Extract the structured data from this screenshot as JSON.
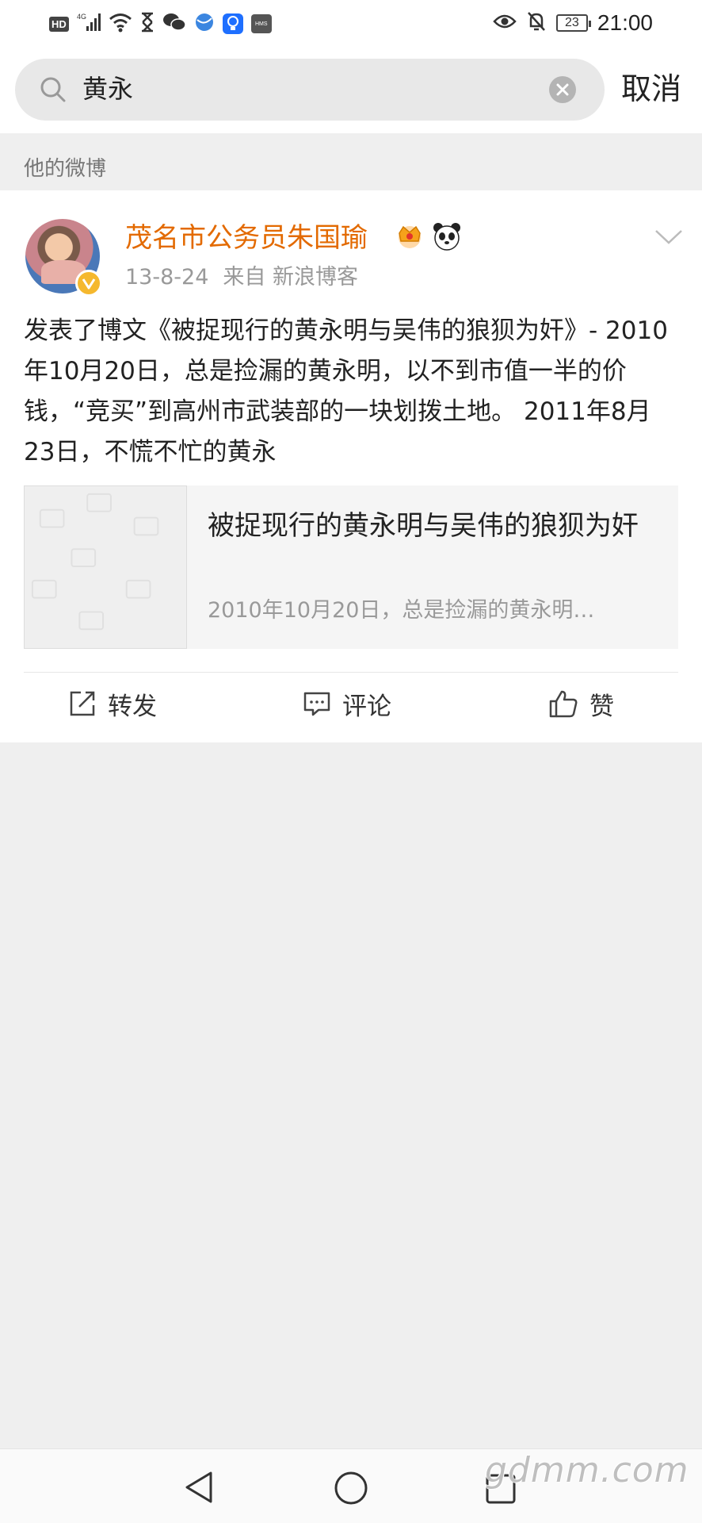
{
  "status_bar": {
    "hd_label": "HD",
    "network_label": "4G",
    "hms_label": "HMS",
    "battery_level": "23",
    "time": "21:00"
  },
  "search": {
    "query": "黄永",
    "cancel_label": "取消"
  },
  "section": {
    "label": "他的微博"
  },
  "post": {
    "author": "茂名市公务员朱国瑜",
    "date": "13-8-24",
    "source": "来自 新浪博客",
    "body": "发表了博文《被捉现行的黄永明与吴伟的狼狈为奸》- 2010年10月20日，总是捡漏的黄永明，以不到市值一半的价钱，“竞买”到高州市武装部的一块划拨土地。 2011年8月23日，不慌不忙的黄永",
    "link_card": {
      "title": "被捉现行的黄永明与吴伟的狼狈为奸",
      "description": "2010年10月20日，总是捡漏的黄永明…"
    },
    "actions": {
      "repost_label": "转发",
      "comment_label": "评论",
      "like_label": "赞"
    }
  },
  "watermark": {
    "text": "gdmm.com"
  },
  "colors": {
    "username": "#e36a00",
    "page_background": "#efefef",
    "verified_badge": "#f5b82e"
  }
}
